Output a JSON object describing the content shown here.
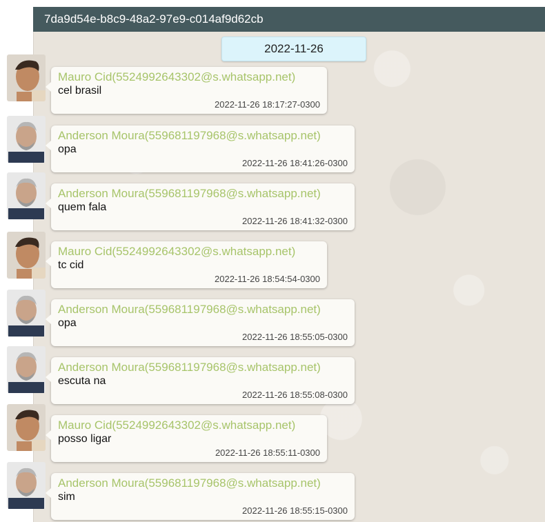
{
  "header": {
    "title": "7da9d54e-b8c9-48a2-97e9-c014af9d62cb"
  },
  "date_divider": "2022-11-26",
  "colors": {
    "header_bg": "#455a5e",
    "sender": "#a7c46a",
    "date_chip": "#dcf4fb",
    "bubble": "#fbfaf6"
  },
  "messages": [
    {
      "sender": "Mauro Cid(5524992643302@s.whatsapp.net)",
      "text": "cel brasil",
      "time": "2022-11-26 18:17:27-0300",
      "avatar": "avatar-mauro-cid"
    },
    {
      "sender": "Anderson Moura(559681197968@s.whatsapp.net)",
      "text": "opa",
      "time": "2022-11-26 18:41:26-0300",
      "avatar": "avatar-anderson-moura"
    },
    {
      "sender": "Anderson Moura(559681197968@s.whatsapp.net)",
      "text": "quem fala",
      "time": "2022-11-26 18:41:32-0300",
      "avatar": "avatar-anderson-moura"
    },
    {
      "sender": "Mauro Cid(5524992643302@s.whatsapp.net)",
      "text": "tc cid",
      "time": "2022-11-26 18:54:54-0300",
      "avatar": "avatar-mauro-cid"
    },
    {
      "sender": "Anderson Moura(559681197968@s.whatsapp.net)",
      "text": "opa",
      "time": "2022-11-26 18:55:05-0300",
      "avatar": "avatar-anderson-moura"
    },
    {
      "sender": "Anderson Moura(559681197968@s.whatsapp.net)",
      "text": "escuta na",
      "time": "2022-11-26 18:55:08-0300",
      "avatar": "avatar-anderson-moura"
    },
    {
      "sender": "Mauro Cid(5524992643302@s.whatsapp.net)",
      "text": "posso ligar",
      "time": "2022-11-26 18:55:11-0300",
      "avatar": "avatar-mauro-cid"
    },
    {
      "sender": "Anderson Moura(559681197968@s.whatsapp.net)",
      "text": "sim",
      "time": "2022-11-26 18:55:15-0300",
      "avatar": "avatar-anderson-moura"
    }
  ]
}
